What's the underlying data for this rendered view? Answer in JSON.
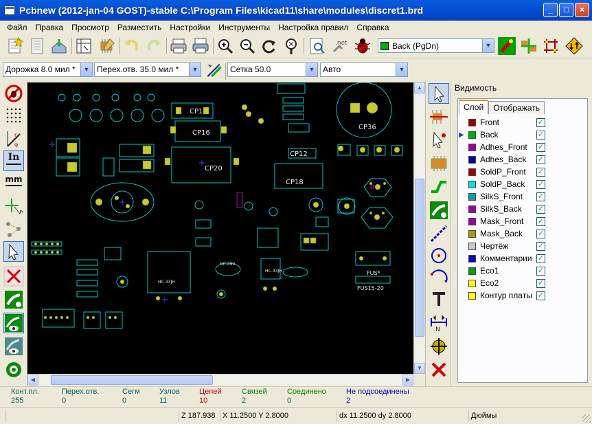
{
  "window": {
    "title": "Pcbnew (2012-jan-04 GOST)-stable C:\\Program Files\\kicad11\\share\\modules\\discret1.brd",
    "minimize": "_",
    "maximize": "□",
    "close": "×"
  },
  "menu": [
    "Файл",
    "Правка",
    "Просмотр",
    "Разместить",
    "Настройки",
    "Инструменты",
    "Настройка правил",
    "Справка"
  ],
  "toolbar": {
    "active_layer": "Back (PgDn)",
    "net_icon_text": ".net"
  },
  "toolbar2": {
    "track_width": "Дорожка 8.0 мил *",
    "via_size": "Перех.отв. 35.0 мил *",
    "grid": "Сетка 50.0",
    "zoom": "Авто"
  },
  "lefttools": {
    "in_label": "In",
    "mm_label": "mm"
  },
  "visibility": {
    "title": "Видимость",
    "tab_layers": "Слой",
    "tab_render": "Отображать",
    "layers": [
      {
        "name": "Front",
        "color": "#a00000",
        "checked": true
      },
      {
        "name": "Back",
        "color": "#00b000",
        "checked": true,
        "current": true
      },
      {
        "name": "Adhes_Front",
        "color": "#a000a0",
        "checked": true
      },
      {
        "name": "Adhes_Back",
        "color": "#0000a0",
        "checked": true
      },
      {
        "name": "SoldP_Front",
        "color": "#a00000",
        "checked": true
      },
      {
        "name": "SoldP_Back",
        "color": "#00e0e0",
        "checked": true
      },
      {
        "name": "SilkS_Front",
        "color": "#00a0a0",
        "checked": true
      },
      {
        "name": "SilkS_Back",
        "color": "#a000a0",
        "checked": true
      },
      {
        "name": "Mask_Front",
        "color": "#a000a0",
        "checked": true
      },
      {
        "name": "Mask_Back",
        "color": "#a0a000",
        "checked": true
      },
      {
        "name": "Чертёж",
        "color": "#c8c8c8",
        "checked": true
      },
      {
        "name": "Комментарии",
        "color": "#0000c0",
        "checked": true
      },
      {
        "name": "Eco1",
        "color": "#00a000",
        "checked": true
      },
      {
        "name": "Eco2",
        "color": "#ffff00",
        "checked": true
      },
      {
        "name": "Контур платы",
        "color": "#ffff00",
        "checked": true
      }
    ],
    "check": "✓"
  },
  "stats": [
    {
      "label": "Конт.пл.",
      "value": "255",
      "label_color": "#005050",
      "value_color": "#006060"
    },
    {
      "label": "Перех.отв.",
      "value": "0",
      "label_color": "#005050",
      "value_color": "#006060"
    },
    {
      "label": "Сегм",
      "value": "0",
      "label_color": "#005050",
      "value_color": "#006060"
    },
    {
      "label": "Узлов",
      "value": "11",
      "label_color": "#005050",
      "value_color": "#006060"
    },
    {
      "label": "Цепей",
      "value": "10",
      "label_color": "#c00000",
      "value_color": "#c00000"
    },
    {
      "label": "Связей",
      "value": "2",
      "label_color": "#008000",
      "value_color": "#006060"
    },
    {
      "label": "Соединено",
      "value": "0",
      "label_color": "#008000",
      "value_color": "#006060"
    },
    {
      "label": "Не подсоединены",
      "value": "2",
      "label_color": "#0000c0",
      "value_color": "#0000c0"
    }
  ],
  "status": {
    "zoom": "Z 187.938",
    "xy": "X 11.2500  Y 2.8000",
    "dxdy": "dx 11.2500  dy 2.8000",
    "units": "Дюймы"
  },
  "board": {
    "labels": [
      "CP14",
      "CP16",
      "CP20",
      "CP18",
      "CP12",
      "CP36",
      "FUS15-20",
      "FUS*",
      "HC-33JH",
      "HC-33JH",
      "HC-49V"
    ]
  },
  "colors": {
    "outline": "#00c8c8",
    "pad": "#c8c832",
    "background": "#000000"
  }
}
